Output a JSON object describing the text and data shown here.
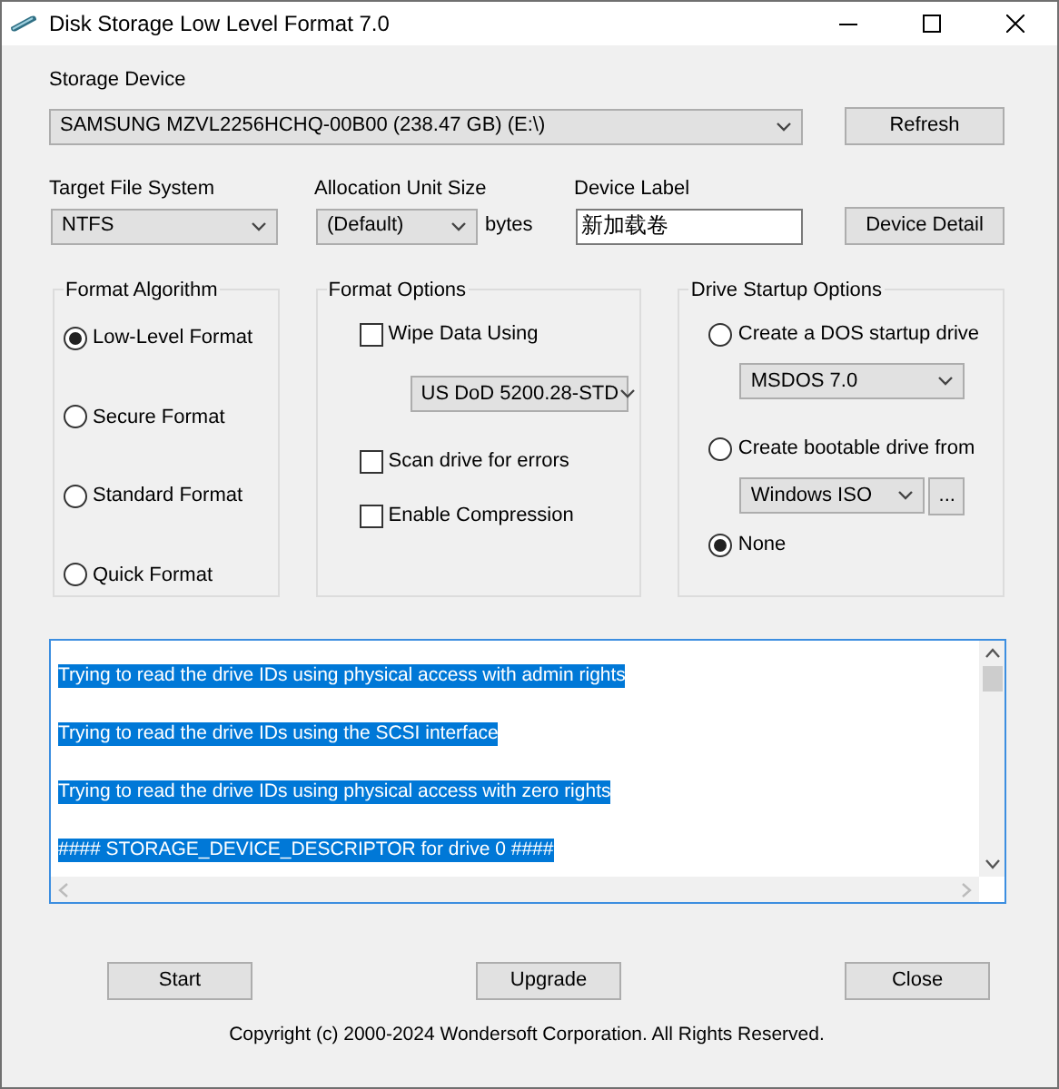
{
  "window": {
    "title": "Disk Storage Low Level Format 7.0"
  },
  "storage_device": {
    "label": "Storage Device",
    "value": "SAMSUNG MZVL2256HCHQ-00B00 (238.47 GB) (E:\\)"
  },
  "refresh_button": "Refresh",
  "target_file_system": {
    "label": "Target File System",
    "value": "NTFS"
  },
  "allocation_unit_size": {
    "label": "Allocation Unit Size",
    "value": "(Default)",
    "unit": "bytes"
  },
  "device_label": {
    "label": "Device Label",
    "value": "新加载卷"
  },
  "device_detail_button": "Device Detail",
  "format_algorithm": {
    "title": "Format Algorithm",
    "options": [
      {
        "label": "Low-Level Format",
        "selected": true
      },
      {
        "label": "Secure Format",
        "selected": false
      },
      {
        "label": "Standard Format",
        "selected": false
      },
      {
        "label": "Quick Format",
        "selected": false
      }
    ]
  },
  "format_options": {
    "title": "Format Options",
    "items": [
      {
        "kind": "checkbox",
        "label": "Wipe Data Using",
        "checked": false
      },
      {
        "kind": "dropdown",
        "value": "US DoD 5200.28-STD"
      },
      {
        "kind": "checkbox",
        "label": "Scan drive for errors",
        "checked": false
      },
      {
        "kind": "checkbox",
        "label": "Enable Compression",
        "checked": false
      }
    ]
  },
  "drive_startup_options": {
    "title": "Drive Startup Options",
    "items": [
      {
        "kind": "radio",
        "label": "Create a DOS startup drive",
        "selected": false
      },
      {
        "kind": "dropdown",
        "value": "MSDOS 7.0"
      },
      {
        "kind": "radio",
        "label": "Create bootable drive from",
        "selected": false
      },
      {
        "kind": "browse",
        "value": "Windows ISO",
        "button": "..."
      },
      {
        "kind": "radio",
        "label": "None",
        "selected": true
      }
    ]
  },
  "log": {
    "lines": [
      {
        "text": "Trying to read the drive IDs using physical access with admin rights",
        "selected": true
      },
      {
        "text": "Trying to read the drive IDs using the SCSI interface",
        "selected": true
      },
      {
        "text": "Trying to read the drive IDs using physical access with zero rights",
        "selected": true
      },
      {
        "text": "#### STORAGE_DEVICE_DESCRIPTOR for drive 0 ####",
        "selected": true
      }
    ]
  },
  "buttons": [
    "Start",
    "Upgrade",
    "Close"
  ],
  "copyright": "Copyright (c) 2000-2024 Wondersoft Corporation. All Rights Reserved."
}
